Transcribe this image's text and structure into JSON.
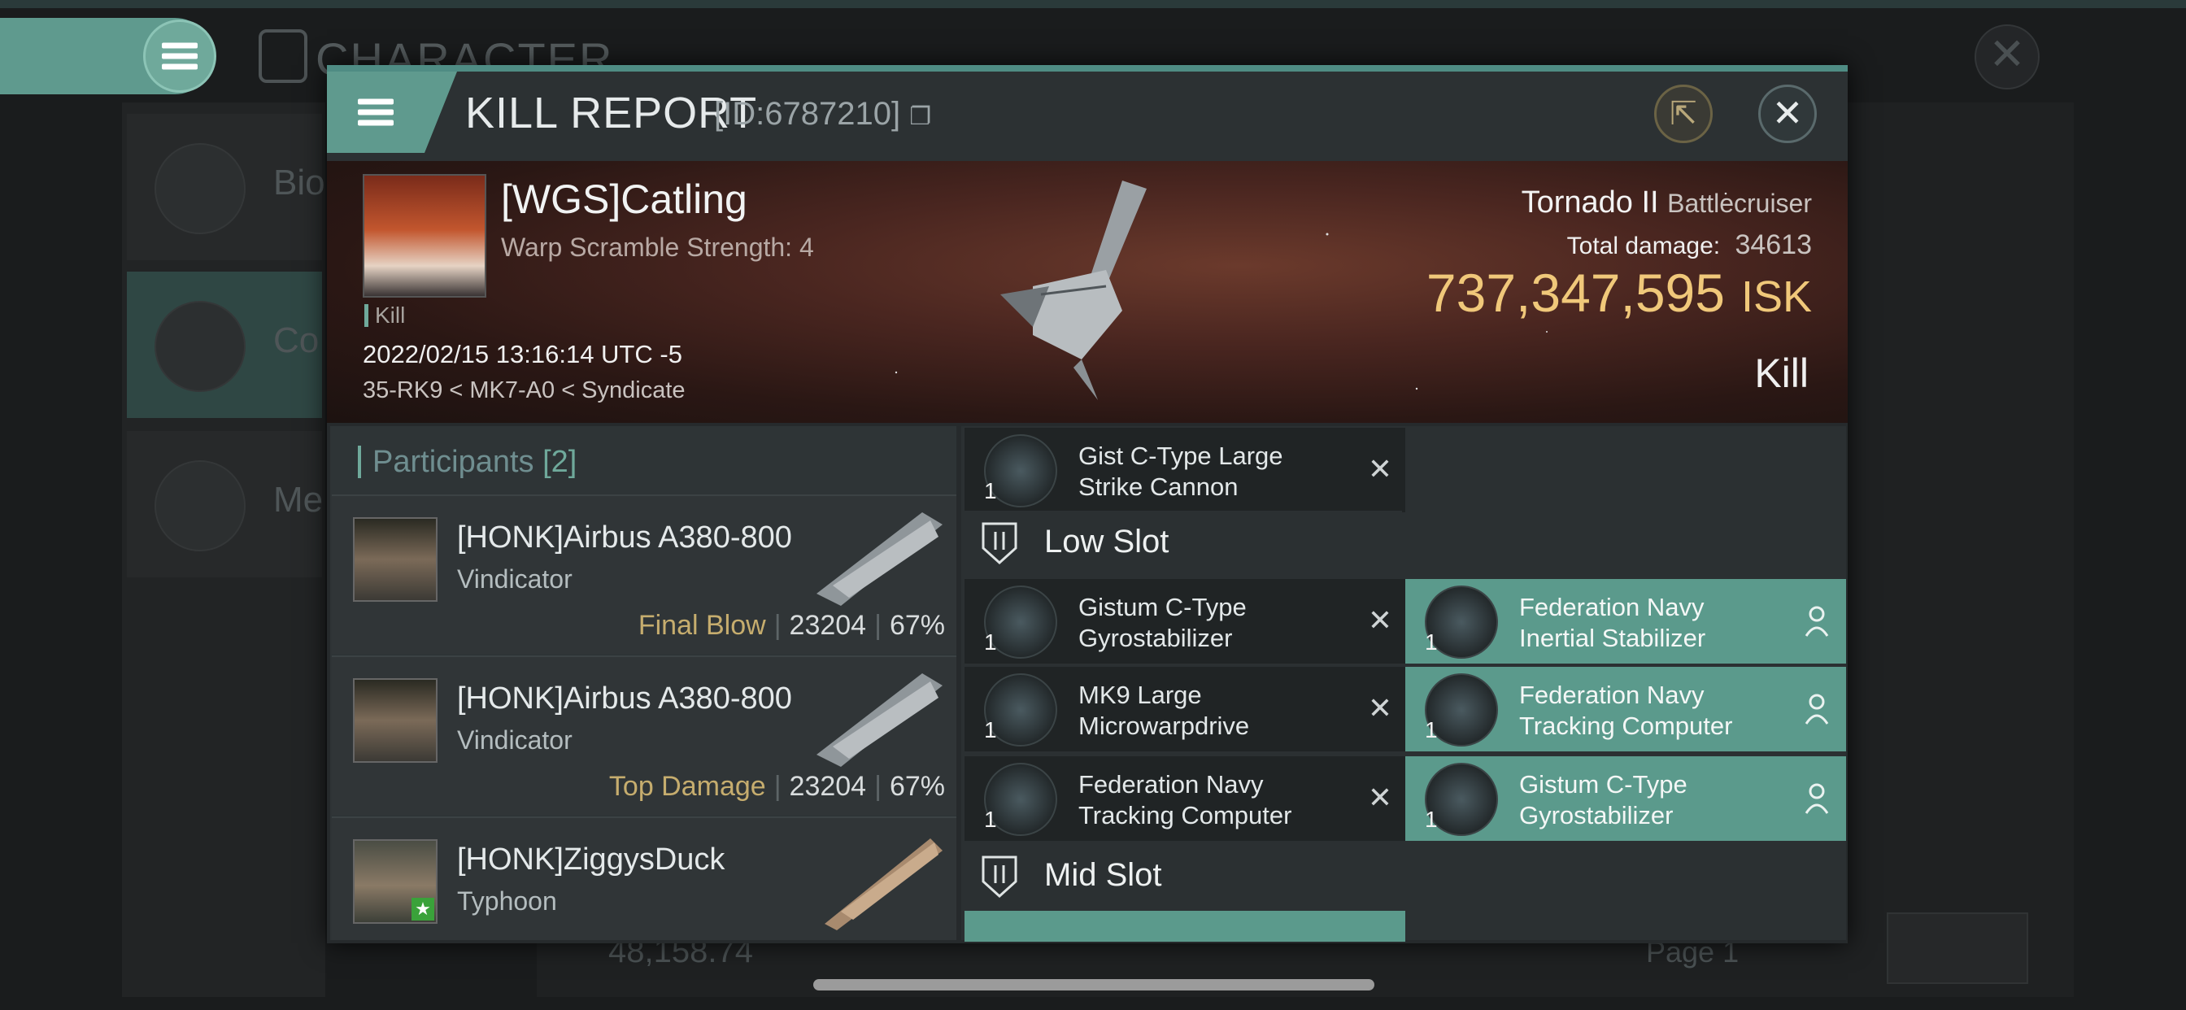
{
  "background": {
    "title": "CHARACTER",
    "sidebar": [
      {
        "label": "Bio"
      },
      {
        "label": "Co"
      },
      {
        "label": "Me"
      }
    ],
    "bottom_value": "48,158.74",
    "page_label": "Page 1"
  },
  "kill_report": {
    "title": "KILL REPORT",
    "id": "[ID:6787210]",
    "victim": {
      "name": "[WGS]Catling",
      "warp_scramble": "Warp Scramble Strength: 4",
      "tag": "Kill",
      "time": "2022/02/15 13:16:14 UTC -5",
      "location": "35-RK9 < MK7-A0 < Syndicate"
    },
    "ship": {
      "name": "Tornado II",
      "class": "Battlecruiser",
      "total_damage_label": "Total damage:",
      "total_damage": "34613",
      "isk_value": "737,347,595",
      "isk_unit": "ISK",
      "result": "Kill"
    },
    "participants": {
      "label": "Participants",
      "count": "[2]",
      "rows": [
        {
          "name": "[HONK]Airbus A380-800",
          "ship": "Vindicator",
          "tag": "Final Blow",
          "damage": "23204",
          "percent": "67%"
        },
        {
          "name": "[HONK]Airbus A380-800",
          "ship": "Vindicator",
          "tag": "Top Damage",
          "damage": "23204",
          "percent": "67%"
        },
        {
          "name": "[HONK]ZiggysDuck",
          "ship": "Typhoon",
          "tag": "",
          "damage": "",
          "percent": ""
        }
      ]
    },
    "modules": {
      "top_item": {
        "qty": "1",
        "name": "Gist C-Type Large Strike Cannon"
      },
      "low_slot_label": "Low Slot",
      "low_slot": [
        {
          "qty": "1",
          "name": "Gistum C-Type Gyrostabilizer",
          "state": "destroyed"
        },
        {
          "qty": "1",
          "name": "Federation Navy Inertial Stabilizer",
          "state": "dropped"
        },
        {
          "qty": "1",
          "name": "MK9 Large Microwarpdrive",
          "state": "destroyed"
        },
        {
          "qty": "1",
          "name": "Federation Navy Tracking Computer",
          "state": "dropped"
        },
        {
          "qty": "1",
          "name": "Federation Navy Tracking Computer",
          "state": "destroyed"
        },
        {
          "qty": "1",
          "name": "Gistum C-Type Gyrostabilizer",
          "state": "dropped"
        }
      ],
      "mid_slot_label": "Mid Slot"
    }
  }
}
